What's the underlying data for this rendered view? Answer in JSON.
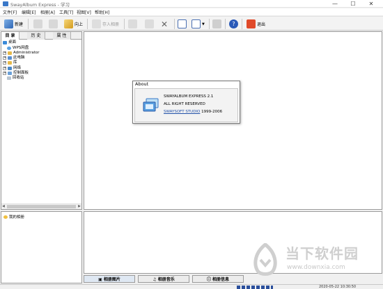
{
  "window": {
    "title": "SwayAlbum Express - 学习",
    "min": "—",
    "max": "☐",
    "close": "✕"
  },
  "menu": [
    "文件[F]",
    "编辑[E]",
    "相册[A]",
    "工具[T]",
    "视图[V]",
    "帮助[H]"
  ],
  "toolbar": {
    "new_label": "新建",
    "up_label": "向上",
    "import_label": "存入相册",
    "exit_label": "退出"
  },
  "left_tabs": [
    "目 录",
    "历 史",
    "属 性"
  ],
  "tree": {
    "desktop": "桌面",
    "wps": "WPS网盘",
    "admin": "Administrator",
    "pc": "此电脑",
    "lib": "库",
    "network": "网络",
    "control": "控制面板",
    "recycle": "回收站"
  },
  "albums": {
    "my_album": "我的相册"
  },
  "bottom_tabs": [
    "相册图片",
    "相册音乐",
    "相册信息"
  ],
  "status": {
    "time": "2020-05-22 10:30:50"
  },
  "about": {
    "title": "About",
    "product": "SWAYALBUM EXPRESS 2.1",
    "rights": "ALL RIGHT RESERVED",
    "company": "SWAYSOFT STUDIO",
    "years": "1999-2006"
  },
  "watermark": {
    "title": "当下软件园",
    "url": "www.downxia.com"
  },
  "colors": {
    "accent": "#2a4f9c",
    "link": "#1f4fa8"
  }
}
